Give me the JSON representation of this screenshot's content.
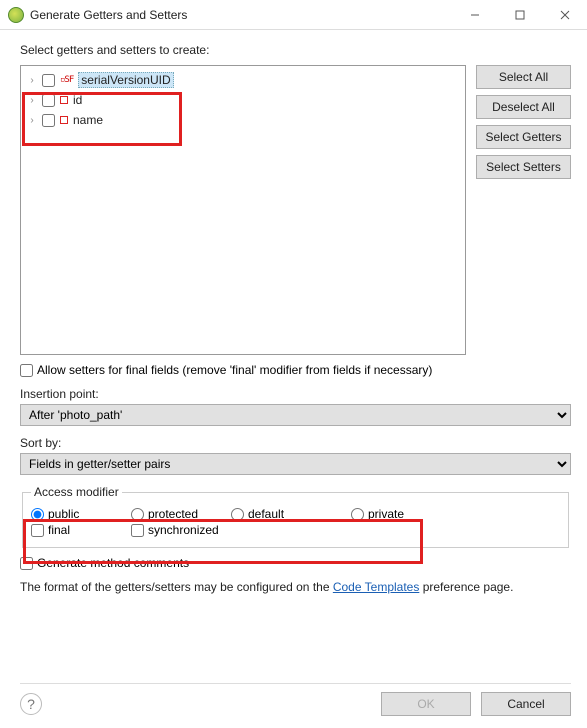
{
  "titlebar": {
    "title": "Generate Getters and Setters"
  },
  "instr": "Select getters and setters to create:",
  "tree": {
    "items": [
      {
        "label": "serialVersionUID",
        "sf": true,
        "selected": true
      },
      {
        "label": "id",
        "sf": false,
        "selected": false
      },
      {
        "label": "name",
        "sf": false,
        "selected": false
      }
    ]
  },
  "sideButtons": {
    "selectAll": "Select All",
    "deselectAll": "Deselect All",
    "selectGetters": "Select Getters",
    "selectSetters": "Select Setters"
  },
  "allowSetters": "Allow setters for final fields (remove 'final' modifier from fields if necessary)",
  "insertionPoint": {
    "label": "Insertion point:",
    "value": "After 'photo_path'"
  },
  "sortBy": {
    "label": "Sort by:",
    "value": "Fields in getter/setter pairs"
  },
  "access": {
    "legend": "Access modifier",
    "public": "public",
    "protected": "protected",
    "default": "default",
    "private": "private",
    "final": "final",
    "synchronized": "synchronized"
  },
  "generateComments": "Generate method comments",
  "footnote": {
    "prefix": "The format of the getters/setters may be configured on the ",
    "link": "Code Templates",
    "suffix": " preference page."
  },
  "buttons": {
    "ok": "OK",
    "cancel": "Cancel"
  }
}
